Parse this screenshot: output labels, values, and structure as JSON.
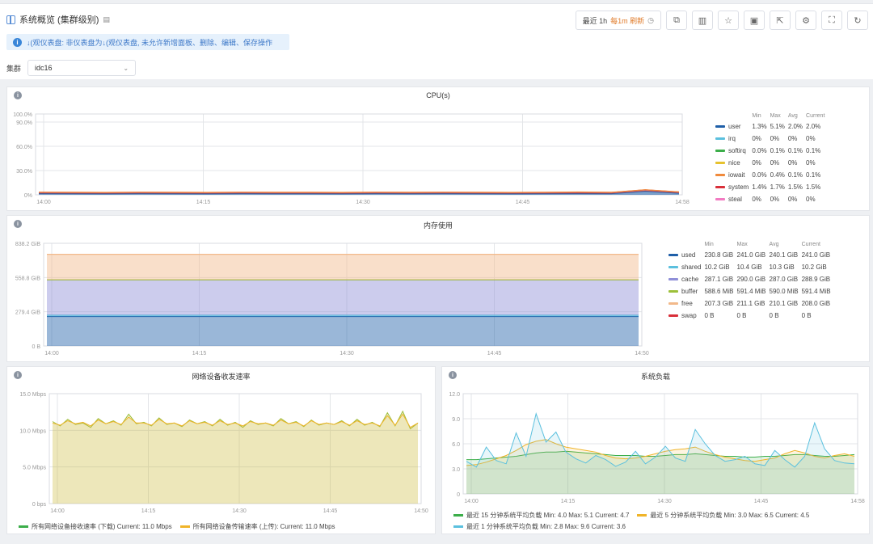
{
  "header": {
    "title": "系统概览 (集群级别)",
    "notice": "↓(观仪表盘: 非仪表盘为↓(观仪表盘, 未允许新增面板、删除、编辑、保存操作",
    "cluster_label": "集群",
    "cluster_value": "idc16",
    "time_range": {
      "prefix": "最近 1h",
      "highlight": "每1m 刷新"
    },
    "toolbar_icons": [
      "copy-icon",
      "chart-add-icon",
      "star-icon",
      "save-icon",
      "share-icon",
      "gear-icon",
      "fullscreen-icon",
      "refresh-icon"
    ]
  },
  "colors": {
    "accent": "#3a86d8",
    "notice_bg": "#e6f1fc"
  },
  "panels": {
    "cpu": {
      "title": "CPU(s)"
    },
    "mem": {
      "title": "内存使用"
    },
    "net": {
      "title": "网络设备收发速率"
    },
    "load": {
      "title": "系统负载"
    }
  },
  "cpu_legend": {
    "headers": [
      "",
      "Min",
      "Max",
      "Avg",
      "Current"
    ],
    "rows": [
      {
        "name": "user",
        "color": "#1f5fa8",
        "min": "1.3%",
        "max": "5.1%",
        "avg": "2.0%",
        "cur": "2.0%"
      },
      {
        "name": "irq",
        "color": "#5bc0de",
        "min": "0%",
        "max": "0%",
        "avg": "0%",
        "cur": "0%"
      },
      {
        "name": "softirq",
        "color": "#3cae4a",
        "min": "0.0%",
        "max": "0.1%",
        "avg": "0.1%",
        "cur": "0.1%"
      },
      {
        "name": "nice",
        "color": "#e6c22f",
        "min": "0%",
        "max": "0%",
        "avg": "0%",
        "cur": "0%"
      },
      {
        "name": "iowait",
        "color": "#f08a3c",
        "min": "0.0%",
        "max": "0.4%",
        "avg": "0.1%",
        "cur": "0.1%"
      },
      {
        "name": "system",
        "color": "#d9303a",
        "min": "1.4%",
        "max": "1.7%",
        "avg": "1.5%",
        "cur": "1.5%"
      },
      {
        "name": "steal",
        "color": "#f27bc2",
        "min": "0%",
        "max": "0%",
        "avg": "0%",
        "cur": "0%"
      }
    ]
  },
  "mem_legend": {
    "headers": [
      "",
      "Min",
      "Max",
      "Avg",
      "Current"
    ],
    "rows": [
      {
        "name": "used",
        "color": "#1f5fa8",
        "min": "230.8 GiB",
        "max": "241.0 GiB",
        "avg": "240.1 GiB",
        "cur": "241.0 GiB"
      },
      {
        "name": "shared",
        "color": "#5bc0de",
        "min": "10.2 GiB",
        "max": "10.4 GiB",
        "avg": "10.3 GiB",
        "cur": "10.2 GiB"
      },
      {
        "name": "cache",
        "color": "#8f8fd8",
        "min": "287.1 GiB",
        "max": "290.0 GiB",
        "avg": "287.0 GiB",
        "cur": "288.9 GiB"
      },
      {
        "name": "buffer",
        "color": "#9dc03a",
        "min": "588.6 MiB",
        "max": "591.4 MiB",
        "avg": "590.0 MiB",
        "cur": "591.4 MiB"
      },
      {
        "name": "free",
        "color": "#f2b98a",
        "min": "207.3 GiB",
        "max": "211.1 GiB",
        "avg": "210.1 GiB",
        "cur": "208.0 GiB"
      },
      {
        "name": "swap",
        "color": "#d9303a",
        "min": "0 B",
        "max": "0 B",
        "avg": "0 B",
        "cur": "0 B"
      }
    ]
  },
  "net_legend": [
    {
      "text": "所有网络设备接收速率 (下载) Current: 11.0 Mbps",
      "color": "#3cae4a"
    },
    {
      "text": "所有网络设备传输速率 (上传): Current: 11.0 Mbps",
      "color": "#f0b429"
    }
  ],
  "load_legend": [
    {
      "text": "最近 15 分钟系统平均负载 Min: 4.0 Max: 5.1 Current: 4.7",
      "color": "#3cae4a"
    },
    {
      "text": "最近 5 分钟系统平均负载 Min: 3.0 Max: 6.5 Current: 4.5",
      "color": "#f0b429"
    },
    {
      "text": "最近 1 分钟系统平均负载 Min: 2.8 Max: 9.6 Current: 3.6",
      "color": "#5bc0de"
    }
  ],
  "chart_data": [
    {
      "type": "area",
      "title": "CPU(s)",
      "x_ticks": [
        "14:00",
        "14:15",
        "14:30",
        "14:45",
        "14:58"
      ],
      "y_ticks": [
        "100.0%",
        "90.0%",
        "60.0%",
        "30.0%",
        "0%"
      ],
      "ylim": [
        0,
        100
      ],
      "series": [
        {
          "name": "user",
          "values": [
            1.6,
            1.5,
            1.4,
            1.6,
            1.5,
            1.4,
            1.6,
            1.5,
            1.5,
            1.4,
            1.6,
            1.5,
            1.6,
            1.5,
            1.4,
            1.5,
            1.6,
            1.5,
            4.5,
            2.0
          ]
        },
        {
          "name": "system",
          "values": [
            1.5,
            1.5,
            1.5,
            1.5,
            1.5,
            1.5,
            1.5,
            1.5,
            1.5,
            1.5,
            1.5,
            1.5,
            1.5,
            1.5,
            1.5,
            1.5,
            1.5,
            1.5,
            1.7,
            1.5
          ]
        },
        {
          "name": "iowait",
          "values": [
            0.1,
            0.1,
            0.1,
            0.1,
            0.1,
            0.1,
            0.1,
            0.1,
            0.1,
            0.1,
            0.1,
            0.1,
            0.1,
            0.1,
            0.1,
            0.1,
            0.4,
            0.1,
            0.1,
            0.1
          ]
        }
      ]
    },
    {
      "type": "area",
      "title": "内存使用",
      "x_ticks": [
        "14:00",
        "14:15",
        "14:30",
        "14:45",
        "14:50"
      ],
      "y_ticks": [
        "838.2 GiB",
        "558.8 GiB",
        "279.4 GiB",
        "0 B"
      ],
      "ylim": [
        0,
        838.2
      ],
      "series": [
        {
          "name": "used",
          "values": [
            241,
            241,
            241,
            241,
            241
          ]
        },
        {
          "name": "shared",
          "values": [
            10.2,
            10.2,
            10.2,
            10.2,
            10.2
          ]
        },
        {
          "name": "cache",
          "values": [
            288.9,
            288.9,
            288.9,
            288.9,
            288.9
          ]
        },
        {
          "name": "buffer",
          "values": [
            0.58,
            0.58,
            0.58,
            0.58,
            0.58
          ]
        },
        {
          "name": "free",
          "values": [
            208,
            208,
            208,
            208,
            208
          ]
        }
      ]
    },
    {
      "type": "area",
      "title": "网络设备收发速率",
      "x_ticks": [
        "14:00",
        "14:15",
        "14:30",
        "14:45",
        "14:50"
      ],
      "y_ticks": [
        "15.0 Mbps",
        "10.0 Mbps",
        "5.0 Mbps",
        "0 bps"
      ],
      "ylim": [
        0,
        15
      ],
      "series": [
        {
          "name": "所有网络设备接收速率 (下载)",
          "values": [
            11.2,
            10.6,
            11.5,
            10.8,
            11.0,
            10.4,
            11.6,
            10.9,
            11.3,
            10.7,
            12.2,
            10.9,
            11.1,
            10.6,
            11.7,
            10.8,
            11.0,
            10.5,
            11.4,
            10.9,
            11.2,
            10.6,
            11.5,
            10.7,
            11.1,
            10.4,
            11.3,
            10.8,
            11.0,
            10.6,
            11.6,
            10.9,
            11.2,
            10.5,
            11.4,
            10.7,
            11.0,
            10.8,
            11.3,
            10.6,
            11.5,
            10.7,
            11.1,
            10.5,
            12.4,
            10.6,
            12.6,
            10.2,
            11.0
          ]
        },
        {
          "name": "所有网络设备传输速率 (上传)",
          "values": [
            11.0,
            10.7,
            11.3,
            10.9,
            11.1,
            10.6,
            11.4,
            10.9,
            11.2,
            10.8,
            11.8,
            11.0,
            11.0,
            10.7,
            11.5,
            10.9,
            11.0,
            10.6,
            11.3,
            10.9,
            11.1,
            10.7,
            11.3,
            10.8,
            11.0,
            10.6,
            11.2,
            10.9,
            11.0,
            10.7,
            11.4,
            10.9,
            11.1,
            10.6,
            11.3,
            10.8,
            11.0,
            10.8,
            11.2,
            10.7,
            11.3,
            10.8,
            11.0,
            10.6,
            12.0,
            10.7,
            12.2,
            10.4,
            11.0
          ]
        }
      ]
    },
    {
      "type": "area",
      "title": "系统负载",
      "x_ticks": [
        "14:00",
        "14:15",
        "14:30",
        "14:45",
        "14:58"
      ],
      "y_ticks": [
        "12.0",
        "9.0",
        "6.0",
        "3.0",
        "0"
      ],
      "ylim": [
        0,
        12
      ],
      "series": [
        {
          "name": "最近 15 分钟系统平均负载",
          "values": [
            4.1,
            4.1,
            4.2,
            4.3,
            4.4,
            4.5,
            4.7,
            4.9,
            5.0,
            5.0,
            5.1,
            5.0,
            4.9,
            4.8,
            4.7,
            4.6,
            4.6,
            4.6,
            4.5,
            4.5,
            4.6,
            4.7,
            4.7,
            4.8,
            4.7,
            4.6,
            4.5,
            4.5,
            4.4,
            4.4,
            4.5,
            4.5,
            4.6,
            4.7,
            4.7,
            4.6,
            4.5,
            4.5,
            4.6,
            4.7
          ]
        },
        {
          "name": "最近 5 分钟系统平均负载",
          "values": [
            3.4,
            3.5,
            3.8,
            4.2,
            4.6,
            5.2,
            5.9,
            6.3,
            6.5,
            6.0,
            5.6,
            5.4,
            5.2,
            5.0,
            4.6,
            4.3,
            4.2,
            4.3,
            4.5,
            4.8,
            5.1,
            5.3,
            5.4,
            5.6,
            5.1,
            4.7,
            4.4,
            4.2,
            4.0,
            3.9,
            4.1,
            4.3,
            4.8,
            5.2,
            4.9,
            4.5,
            4.3,
            4.6,
            4.8,
            4.5
          ]
        },
        {
          "name": "最近 1 分钟系统平均负载",
          "values": [
            3.9,
            3.2,
            5.6,
            4.0,
            3.6,
            7.3,
            4.5,
            9.6,
            6.2,
            7.4,
            5.0,
            4.2,
            3.7,
            4.6,
            4.1,
            3.3,
            3.8,
            5.1,
            3.6,
            4.4,
            5.7,
            4.3,
            3.9,
            7.7,
            6.0,
            4.6,
            3.9,
            4.1,
            4.5,
            3.6,
            3.4,
            5.2,
            4.1,
            3.2,
            4.5,
            8.5,
            5.4,
            4.0,
            3.7,
            3.6
          ]
        }
      ]
    }
  ]
}
